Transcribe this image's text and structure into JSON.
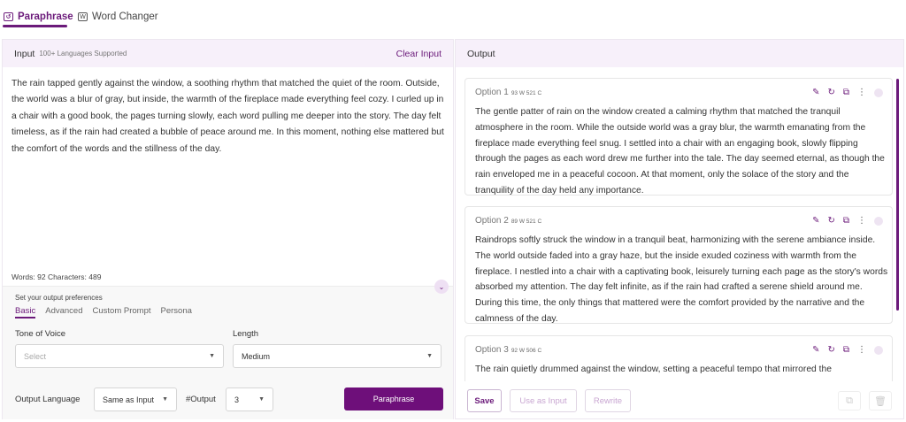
{
  "tabs": [
    {
      "label": "Paraphrase",
      "icon": "paraphrase-icon",
      "active": true
    },
    {
      "label": "Word Changer",
      "icon": "word-changer-icon",
      "active": false
    }
  ],
  "input": {
    "title": "Input",
    "subtitle": "100+ Languages Supported",
    "clear_label": "Clear Input",
    "text": "The rain tapped gently against the window, a soothing rhythm that matched the quiet of the room. Outside, the world was a blur of gray, but inside, the warmth of the fireplace made everything feel cozy. I curled up in a chair with a good book, the pages turning slowly, each word pulling me deeper into the story. The day felt timeless, as if the rain had created a bubble of peace around me. In this moment, nothing else mattered but the comfort of the words and the stillness of the day.",
    "counts": "Words: 92 Characters: 489"
  },
  "preferences": {
    "title": "Set your output preferences",
    "tabs": [
      "Basic",
      "Advanced",
      "Custom Prompt",
      "Persona"
    ],
    "active_tab": "Basic",
    "tone_label": "Tone of Voice",
    "tone_placeholder": "Select",
    "length_label": "Length",
    "length_value": "Medium",
    "output_language_label": "Output Language",
    "output_language_value": "Same as Input",
    "num_output_label": "#Output",
    "num_output_value": "3",
    "paraphrase_button": "Paraphrase"
  },
  "output": {
    "title": "Output",
    "options": [
      {
        "label": "Option 1",
        "meta": "93 W 521 C",
        "text": "The gentle patter of rain on the window created a calming rhythm that matched the tranquil atmosphere in the room. While the outside world was a gray blur, the warmth emanating from the fireplace made everything feel snug. I settled into a chair with an engaging book, slowly flipping through the pages as each word drew me further into the tale. The day seemed eternal, as though the rain enveloped me in a peaceful cocoon. At that moment, only the solace of the story and the tranquility of the day held any importance."
      },
      {
        "label": "Option 2",
        "meta": "89 W 521 C",
        "text": "Raindrops softly struck the window in a tranquil beat, harmonizing with the serene ambiance inside. The world outside faded into a gray haze, but the inside exuded coziness with warmth from the fireplace. I nestled into a chair with a captivating book, leisurely turning each page as the story's words absorbed my attention. The day felt infinite, as if the rain had crafted a serene shield around me. During this time, the only things that mattered were the comfort provided by the narrative and the calmness of the day."
      },
      {
        "label": "Option 3",
        "meta": "92 W 506 C",
        "text": "The rain quietly drummed against the window, setting a peaceful tempo that mirrored the"
      }
    ],
    "save_label": "Save",
    "use_as_input_label": "Use as Input",
    "rewrite_label": "Rewrite"
  },
  "colors": {
    "accent": "#6b1a7a",
    "header_bg": "#f7f0fa",
    "button_bg": "#6e0f7a"
  }
}
